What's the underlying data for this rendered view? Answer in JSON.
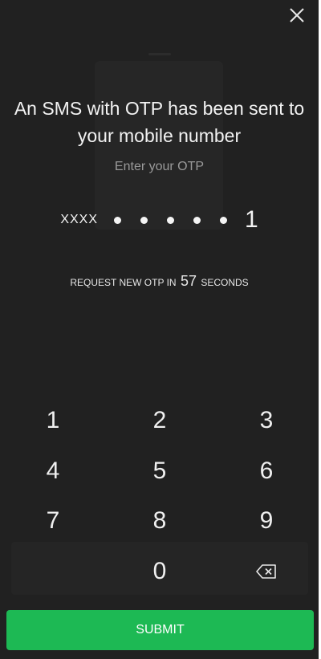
{
  "header": {
    "close_icon": "close-icon"
  },
  "otp_screen": {
    "title": "An SMS with OTP has been sent to your mobile number",
    "subtitle": "Enter your OTP",
    "masked_prefix": "XXXX",
    "masked_digit_count": 5,
    "last_digit": "1",
    "resend_before": "REQUEST NEW OTP IN",
    "resend_seconds": "57",
    "resend_after": "SECONDS"
  },
  "keypad": {
    "keys": [
      "1",
      "2",
      "3",
      "4",
      "5",
      "6",
      "7",
      "8",
      "9",
      "0"
    ],
    "backspace_icon": "backspace-icon"
  },
  "submit": {
    "label": "SUBMIT"
  },
  "colors": {
    "background": "#212121",
    "accent": "#1db954",
    "text": "#f2f2f2",
    "muted": "#9a9a9a"
  }
}
